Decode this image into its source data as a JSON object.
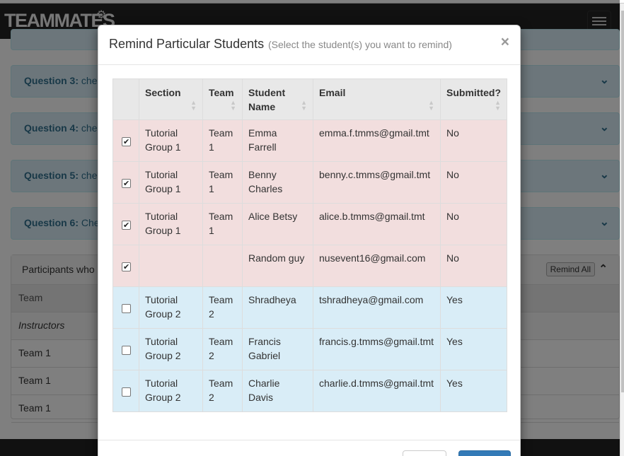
{
  "navbar": {
    "brand": "TEAMMATES"
  },
  "questions": [
    {
      "label": "Question 3:",
      "text": "che"
    },
    {
      "label": "Question 4:",
      "text": "che"
    },
    {
      "label": "Question 5:",
      "text": "che"
    },
    {
      "label": "Question 6:",
      "text": "Che"
    }
  ],
  "participants": {
    "header": "Participants who",
    "remind_all_label": "Remind All",
    "column_team": "Team",
    "rows": [
      "Instructors",
      "Team 1",
      "Team 1",
      "Team 1"
    ]
  },
  "modal": {
    "title": "Remind Particular Students",
    "subtitle": "(Select the student(s) you want to remind)",
    "close": "×",
    "columns": [
      "Section",
      "Team",
      "Student Name",
      "Email",
      "Submitted?"
    ],
    "students": [
      {
        "checked": true,
        "section": "Tutorial Group 1",
        "team": "Team 1",
        "name": "Emma Farrell",
        "email": "emma.f.tmms@gmail.tmt",
        "submitted": "No"
      },
      {
        "checked": true,
        "section": "Tutorial Group 1",
        "team": "Team 1",
        "name": "Benny Charles",
        "email": "benny.c.tmms@gmail.tmt",
        "submitted": "No"
      },
      {
        "checked": true,
        "section": "Tutorial Group 1",
        "team": "Team 1",
        "name": "Alice Betsy",
        "email": "alice.b.tmms@gmail.tmt",
        "submitted": "No"
      },
      {
        "checked": true,
        "section": "",
        "team": "",
        "name": "Random guy",
        "email": "nusevent16@gmail.com",
        "submitted": "No"
      },
      {
        "checked": false,
        "section": "Tutorial Group 2",
        "team": "Team 2",
        "name": "Shradheya",
        "email": "tshradheya@gmail.com",
        "submitted": "Yes"
      },
      {
        "checked": false,
        "section": "Tutorial Group 2",
        "team": "Team 2",
        "name": "Francis Gabriel",
        "email": "francis.g.tmms@gmail.tmt",
        "submitted": "Yes"
      },
      {
        "checked": false,
        "section": "Tutorial Group 2",
        "team": "Team 2",
        "name": "Charlie Davis",
        "email": "charlie.d.tmms@gmail.tmt",
        "submitted": "Yes"
      }
    ]
  },
  "colors": {
    "not_submitted_row": "#f2dede",
    "submitted_row": "#d9edf7",
    "navbar": "#222222",
    "primary": "#337ab7"
  }
}
